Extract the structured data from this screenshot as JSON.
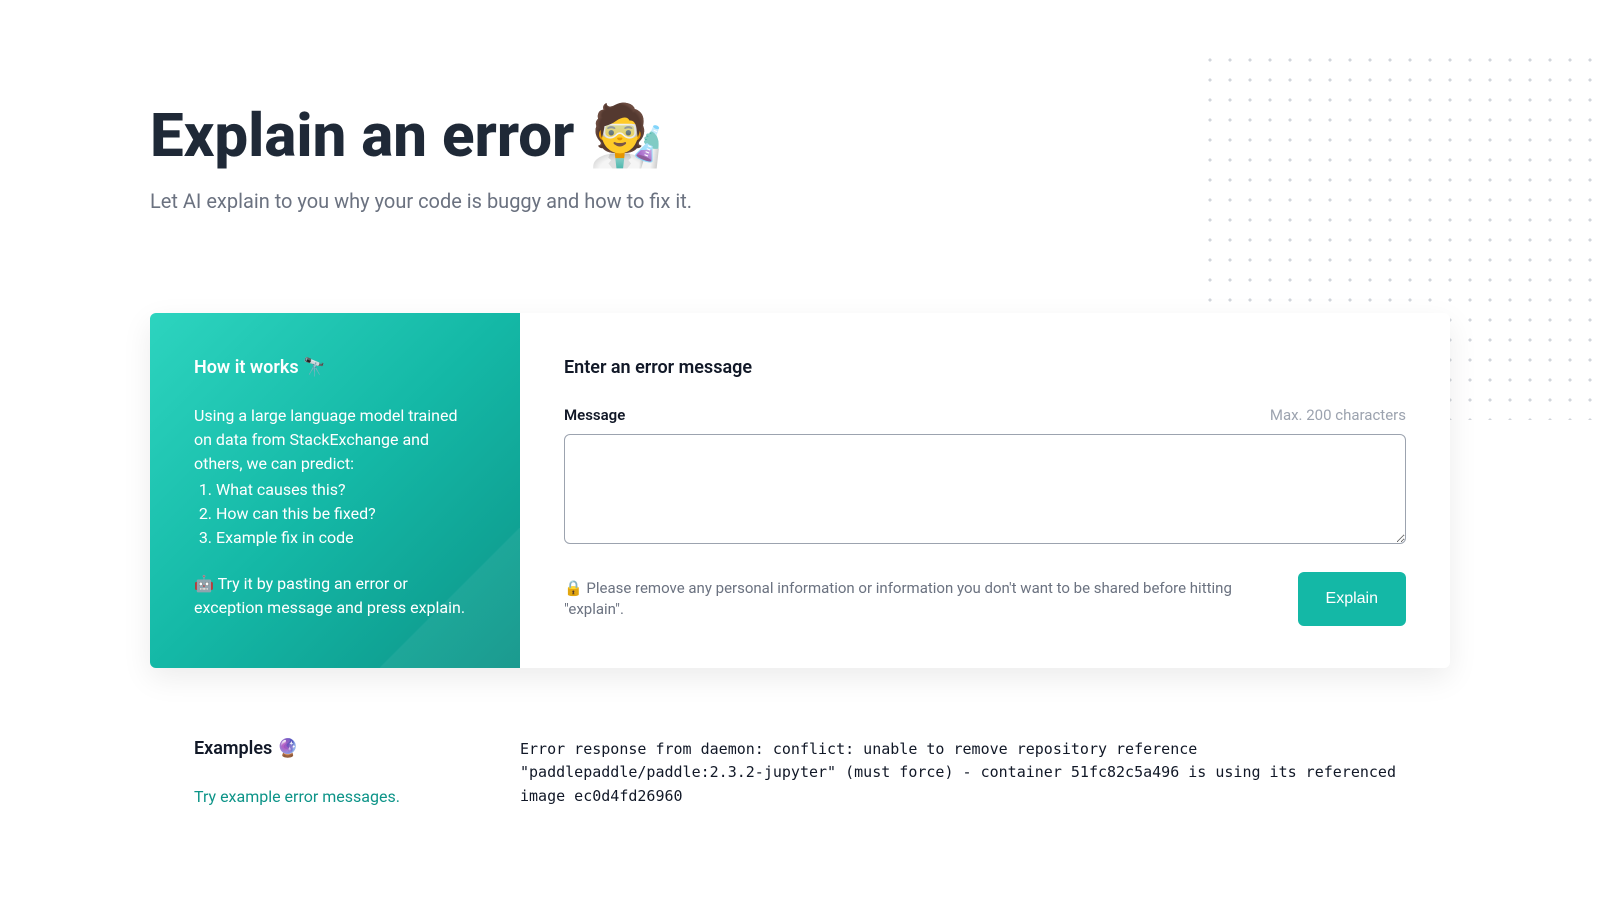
{
  "header": {
    "title": "Explain an error 🧑‍🔬",
    "subtitle": "Let AI explain to you why your code is buggy and how to fix it."
  },
  "sidebar": {
    "title": "How it works 🔭",
    "intro": "Using a large language model trained on data from StackExchange and others, we can predict:",
    "list": {
      "item1": "What causes this?",
      "item2": "How can this be fixed?",
      "item3": "Example fix in code"
    },
    "tryit": "🤖 Try it by pasting an error or exception message and press explain."
  },
  "panel": {
    "title": "Enter an error message",
    "message_label": "Message",
    "char_limit": "Max. 200 characters",
    "textarea_value": "",
    "privacy_note": "🔒 Please remove any personal information or information you don't want to be shared before hitting \"explain\".",
    "explain_button": "Explain"
  },
  "examples": {
    "title": "Examples 🔮",
    "subtitle": "Try example error messages.",
    "code": "Error response from daemon: conflict: unable to remove repository reference \"paddlepaddle/paddle:2.3.2-jupyter\" (must force) - container 51fc82c5a496 is using its referenced image ec0d4fd26960"
  }
}
